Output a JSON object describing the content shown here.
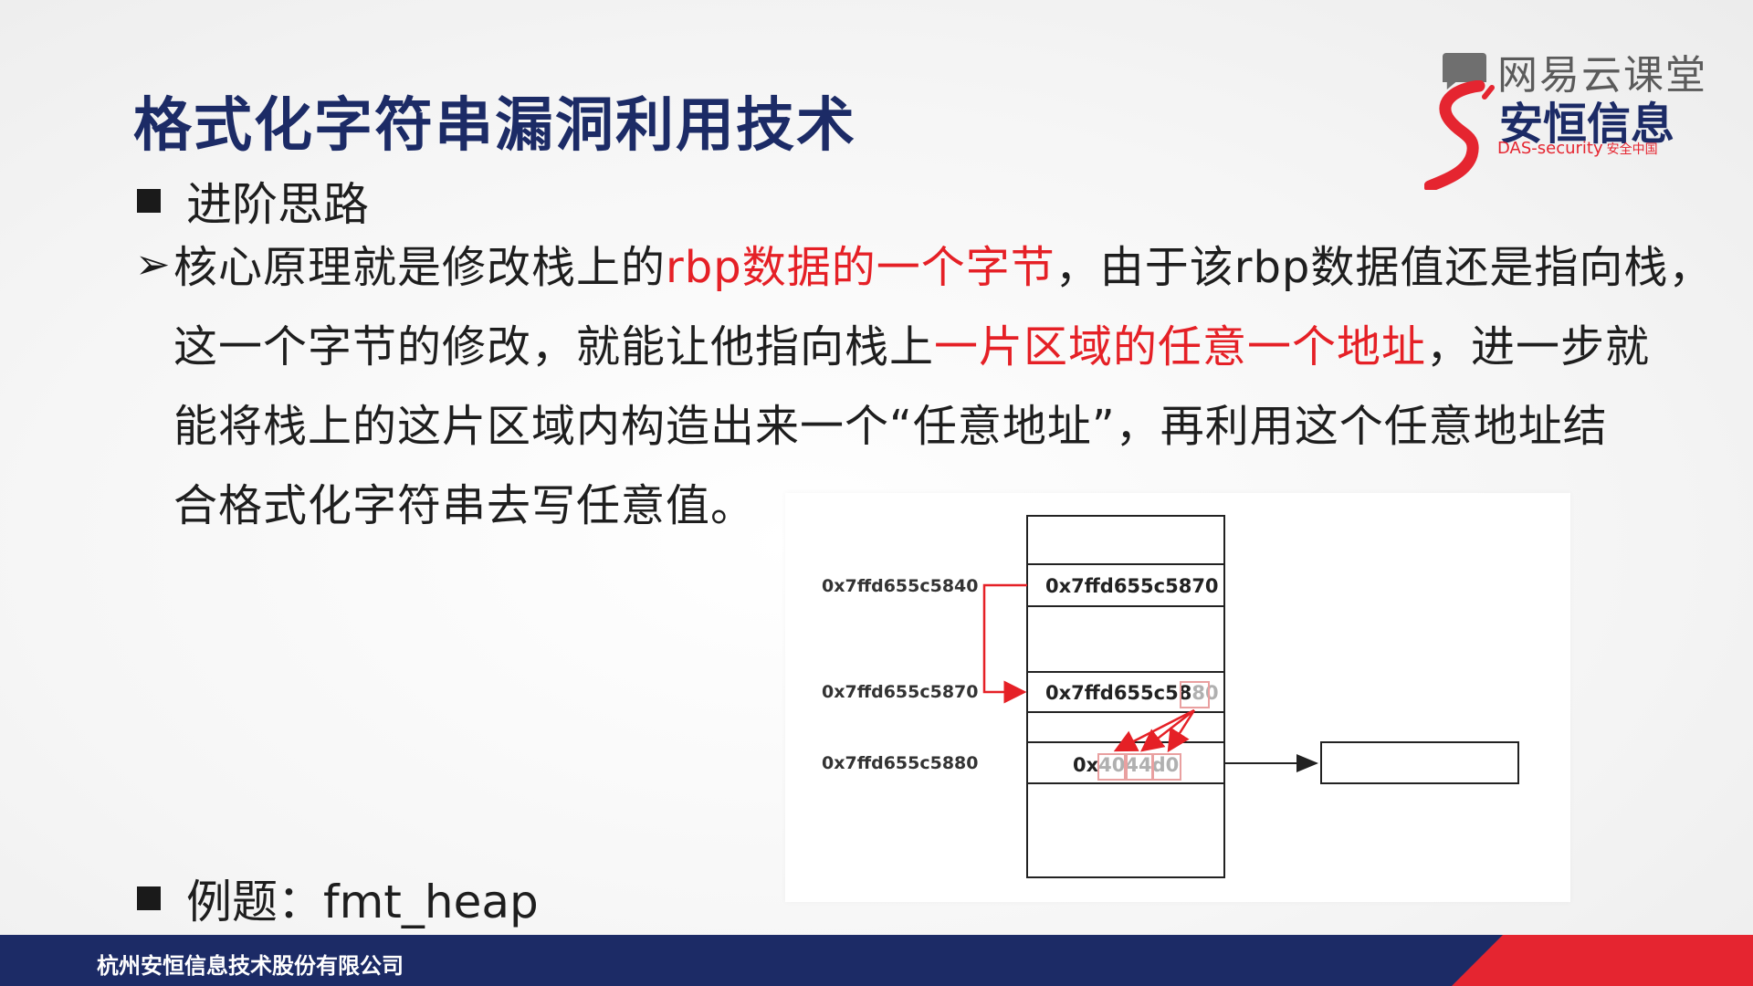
{
  "slide": {
    "title": "格式化字符串漏洞利用技术",
    "logo": {
      "brand_top": "网易云课堂",
      "brand_cn": "安恒信息",
      "brand_en": "DAS-security",
      "brand_en_sub": "安全中国"
    },
    "section1": "进阶思路",
    "bullet_marker": "➢",
    "paragraph": {
      "l1_a": "核心原理就是修改栈上的",
      "l1_red": "rbp数据的一个字节",
      "l1_b": "，由于该rbp数据值还是指向栈，",
      "l2_a": "这一个字节的修改，就能让他指向栈上",
      "l2_red": "一片区域的任意一个地址",
      "l2_b": "，进一步就",
      "l3": "能将栈上的这片区域内构造出来一个“任意地址”，再利用这个任意地址结",
      "l4": "合格式化字符串去写任意值。"
    },
    "section2": "例题：fmt_heap",
    "footer": "杭州安恒信息技术股份有限公司"
  },
  "diagram": {
    "addresses": [
      "0x7ffd655c5840",
      "0x7ffd655c5870",
      "0x7ffd655c5880"
    ],
    "cell1_value": "0x7ffd655c5870",
    "cell2_prefix": "0x7ffd655c58",
    "cell2_highlight": "80",
    "cell3_prefix": "0x",
    "cell3_bytes": [
      "40",
      "44",
      "d0"
    ],
    "colors": {
      "arrow": "#e52026",
      "highlight_box": "#e9a0a0",
      "faded_text": "#b0b0b0"
    }
  },
  "colors": {
    "title": "#1c2b66",
    "accent_red": "#e52530",
    "footer": "#1c2b66"
  }
}
